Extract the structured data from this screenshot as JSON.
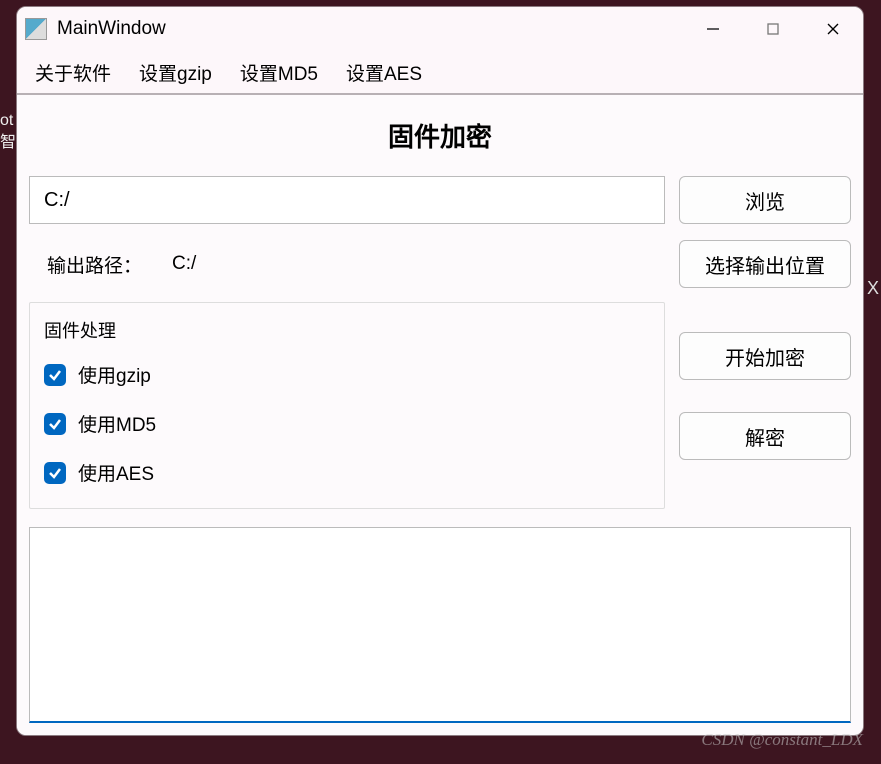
{
  "bg_fragments": [
    "ot",
    "智能"
  ],
  "window": {
    "title": "MainWindow"
  },
  "menu": {
    "items": [
      "关于软件",
      "设置gzip",
      "设置MD5",
      "设置AES"
    ]
  },
  "page": {
    "title": "固件加密"
  },
  "input_path": "C:/",
  "output": {
    "label": "输出路径：",
    "value": "C:/"
  },
  "buttons": {
    "browse": "浏览",
    "choose_output": "选择输出位置",
    "encrypt": "开始加密",
    "decrypt": "解密"
  },
  "fieldset": {
    "legend": "固件处理",
    "options": [
      {
        "label": "使用gzip",
        "checked": true
      },
      {
        "label": "使用MD5",
        "checked": true
      },
      {
        "label": "使用AES",
        "checked": true
      }
    ]
  },
  "watermark": "CSDN @constant_LDX",
  "right_edge_char": "X"
}
